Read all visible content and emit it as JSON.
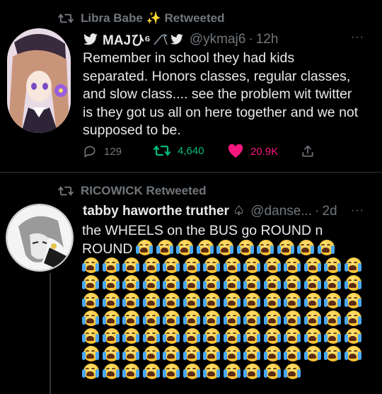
{
  "tweet1": {
    "retweeted_by": "Libra Babe ✨ Retweeted",
    "author_name": "MAJひ⁶",
    "handle": "@ykmaj6",
    "separator": "·",
    "time": "12h",
    "more": "···",
    "text_lines": [
      "Remember in school they had kids",
      "separated. Honors classes, regular classes,",
      "and slow class.... see the problem wit twitter",
      "is they got us all on here together and we not",
      "supposed to be."
    ],
    "reply_count": "129",
    "retweet_count": "4,640",
    "like_count": "20.9K",
    "colors": {
      "retweet": "#00ba7c",
      "like": "#f91880",
      "muted": "#71767b"
    }
  },
  "tweet2": {
    "retweeted_by": "RICOWICK Retweeted",
    "author_name": "tabby haworthe truther ♤",
    "handle": "@danse...",
    "separator": "·",
    "time": "2d",
    "more": "···",
    "text_lines": [
      "the WHEELS on the BUS go ROUND n",
      "ROUND"
    ],
    "emoji_name": "loudly-crying-face",
    "emoji_rows": [
      10,
      14,
      14,
      14,
      14,
      14,
      14,
      11
    ]
  }
}
